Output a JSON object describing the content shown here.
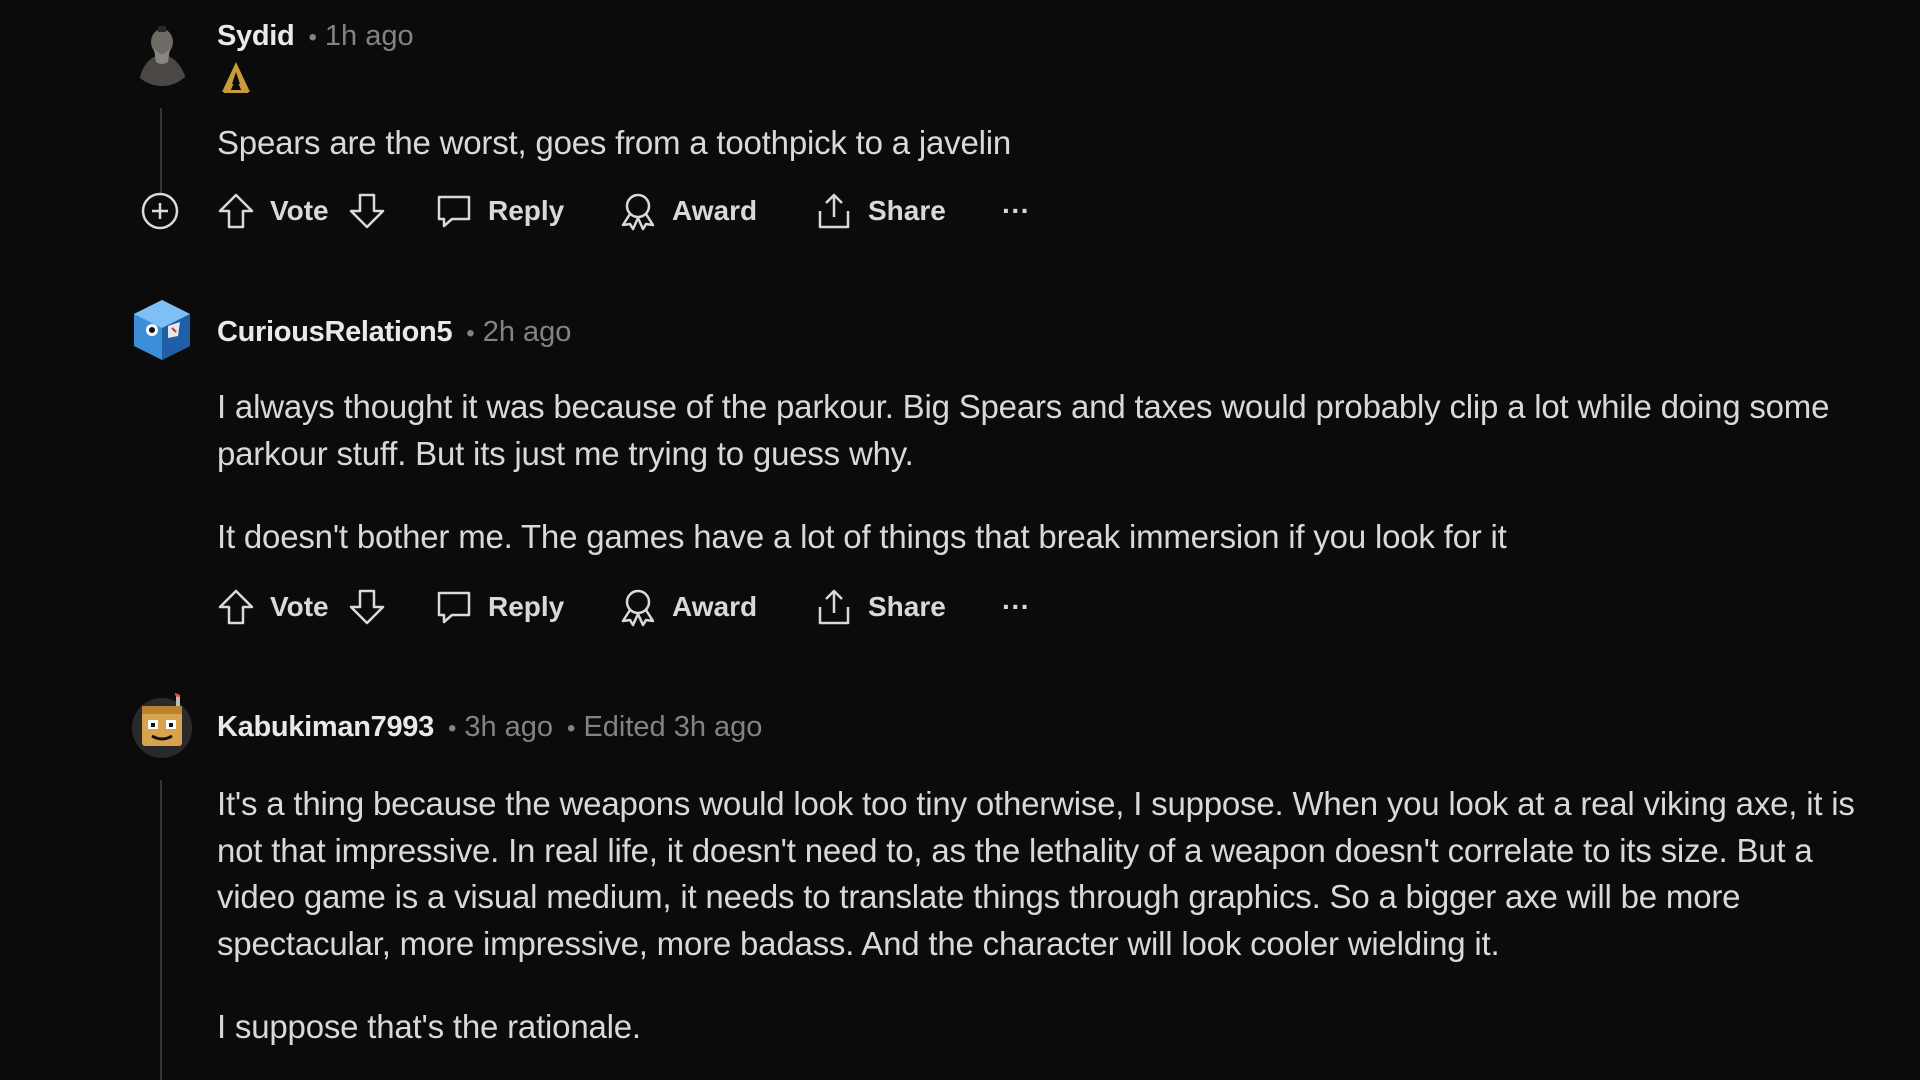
{
  "comments": [
    {
      "author": "Sydid",
      "time": "1h ago",
      "edited": "",
      "flair_icon": "assassins-creed-flair-icon",
      "paragraphs": [
        "Spears are the worst, goes from a toothpick to a javelin"
      ],
      "actions": {
        "vote": "Vote",
        "reply": "Reply",
        "award": "Award",
        "share": "Share",
        "more": "···"
      }
    },
    {
      "author": "CuriousRelation5",
      "time": "2h ago",
      "edited": "",
      "paragraphs": [
        "I always thought it was because of the parkour. Big Spears and taxes would probably clip a lot while doing some parkour stuff. But its just me trying to guess why.",
        "It doesn't bother me. The games have a lot of things that break immersion if you look for it"
      ],
      "actions": {
        "vote": "Vote",
        "reply": "Reply",
        "award": "Award",
        "share": "Share",
        "more": "···"
      }
    },
    {
      "author": "Kabukiman7993",
      "time": "3h ago",
      "edited": "Edited 3h ago",
      "paragraphs": [
        "It's a thing because the weapons would look too tiny otherwise, I suppose. When you look at a real viking axe, it is not that impressive. In real life, it doesn't need to, as the lethality of a weapon doesn't correlate to its size. But a video game is a visual medium, it needs to translate things through graphics. So a bigger axe will be more spectacular, more impressive, more badass. And the character will look cooler wielding it.",
        "I suppose that's the rationale."
      ]
    }
  ],
  "separator": "•",
  "colors": {
    "background": "#0b0b0b",
    "text": "#d7dadc",
    "muted": "#818384",
    "thread_line": "#343536"
  }
}
